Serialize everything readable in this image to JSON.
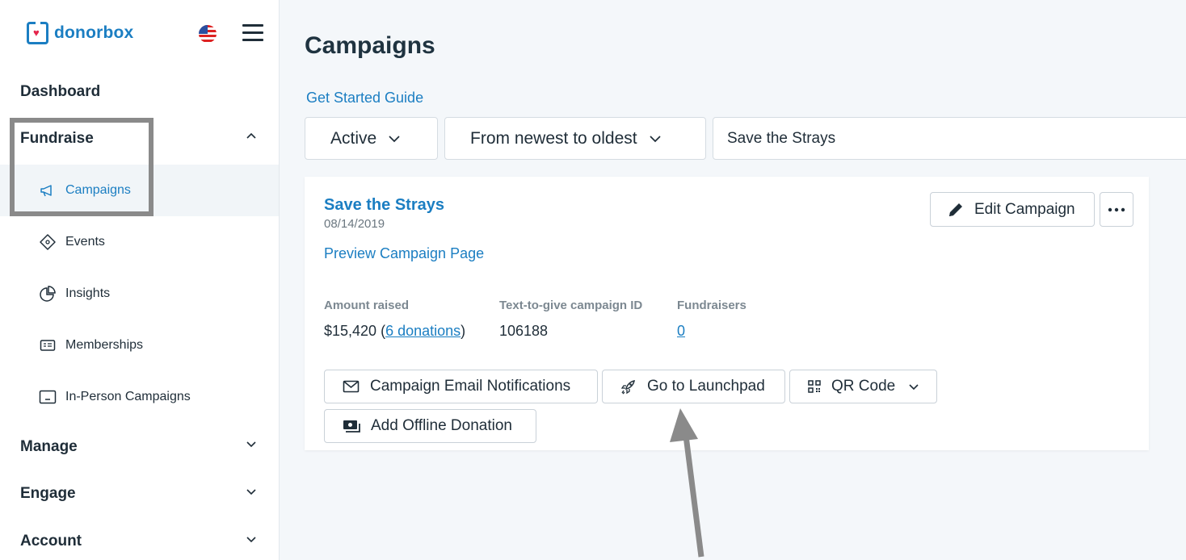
{
  "brand": {
    "name": "donorbox"
  },
  "sidebar": {
    "dashboard": "Dashboard",
    "fundraise": "Fundraise",
    "items": [
      {
        "label": "Campaigns",
        "icon": "megaphone-icon"
      },
      {
        "label": "Events",
        "icon": "ticket-icon"
      },
      {
        "label": "Insights",
        "icon": "pie-chart-icon"
      },
      {
        "label": "Memberships",
        "icon": "membership-card-icon"
      },
      {
        "label": "In-Person Campaigns",
        "icon": "tablet-icon"
      }
    ],
    "manage": "Manage",
    "engage": "Engage",
    "account": "Account"
  },
  "main": {
    "title": "Campaigns",
    "guide_link": "Get Started Guide",
    "filters": {
      "status": "Active",
      "sort": "From newest to oldest"
    },
    "search": {
      "value": "Save the Strays"
    }
  },
  "campaign": {
    "name": "Save the Strays",
    "date": "08/14/2019",
    "preview": "Preview Campaign Page",
    "edit": "Edit Campaign",
    "stats": {
      "amount_label": "Amount raised",
      "amount": "$15,420",
      "donations": "6 donations",
      "text_id_label": "Text-to-give campaign ID",
      "text_id": "106188",
      "fundraisers_label": "Fundraisers",
      "fundraisers": "0"
    },
    "actions": {
      "email": "Campaign Email Notifications",
      "launchpad": "Go to Launchpad",
      "qr": "QR Code",
      "offline": "Add Offline Donation"
    }
  },
  "colors": {
    "accent": "#1b7ec2",
    "heart": "#e5254c",
    "annotation": "#8a8a8a"
  }
}
